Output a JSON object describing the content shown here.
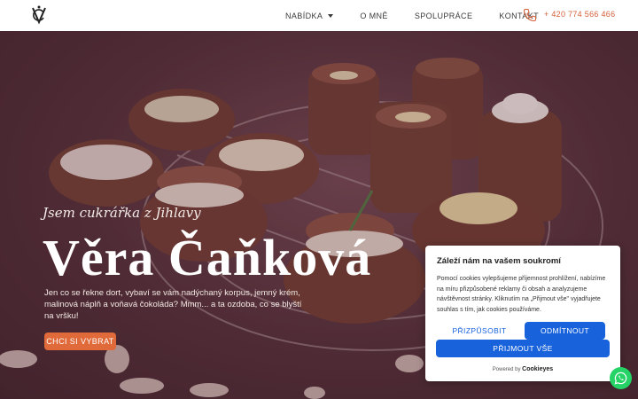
{
  "header": {
    "logo": "vc-monogram-logo",
    "nav": [
      {
        "label": "NABÍDKA",
        "has_dropdown": true
      },
      {
        "label": "O MNĚ"
      },
      {
        "label": "SPOLUPRÁCE"
      },
      {
        "label": "KONTAKT"
      }
    ],
    "phone_icon": "phone-icon",
    "phone": "+ 420 774 566 466"
  },
  "hero": {
    "subtitle": "Jsem cukrářka z Jihlavy",
    "title": "Věra Čaňková",
    "description": "Jen co se řekne dort, vybaví se vám nadýchaný korpus, jemný krém, malinová náplň a voňavá čokoláda? Mmm... a ta ozdoba, co se blyští na vršku!",
    "cta": "CHCI SI VYBRAT"
  },
  "cookie": {
    "title": "Záleží nám na vašem soukromí",
    "text": "Pomocí cookies vylepšujeme příjemnost prohlížení, nabízíme na míru přizpůsobené reklamy či obsah a analyzujeme návštěvnost stránky. Kliknutím na „Přijmout vše\" vyjadřujete souhlas s tím, jak cookies používáme.",
    "customize": "PŘIZPŮSOBIT",
    "reject": "ODMÍTNOUT",
    "accept": "PŘIJMOUT VŠE",
    "powered_by": "Powered by",
    "powered_brand": "Cookieyes"
  },
  "whatsapp": "whatsapp-icon",
  "colors": {
    "accent": "#e06a3a",
    "phone": "#d4603a",
    "cookie_blue": "#1863dc"
  }
}
